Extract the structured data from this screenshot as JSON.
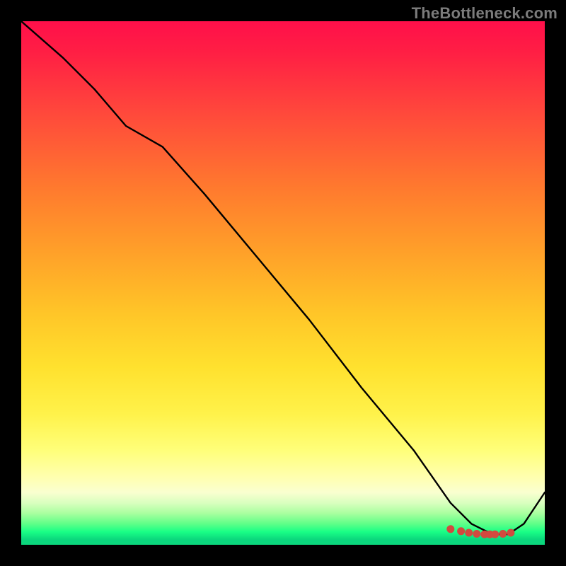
{
  "watermark": "TheBottleneck.com",
  "chart_data": {
    "type": "line",
    "title": "",
    "xlabel": "",
    "ylabel": "",
    "xlim": [
      0,
      100
    ],
    "ylim": [
      0,
      100
    ],
    "grid": false,
    "series": [
      {
        "name": "curve",
        "x": [
          0,
          8,
          14,
          20,
          27,
          35,
          45,
          55,
          65,
          75,
          82,
          86,
          90,
          93,
          96,
          100
        ],
        "values": [
          100,
          93,
          87,
          80,
          76,
          67,
          55,
          43,
          30,
          18,
          8,
          4,
          2,
          2,
          4,
          10
        ]
      }
    ],
    "markers": {
      "x": [
        82,
        84,
        85.5,
        87,
        88.5,
        89.5,
        90.5,
        92,
        93.5
      ],
      "values": [
        3.0,
        2.6,
        2.3,
        2.1,
        2.0,
        2.0,
        2.0,
        2.1,
        2.3
      ]
    },
    "background_gradient": {
      "orientation": "vertical",
      "stops": [
        {
          "pos": 0.0,
          "color": "#ff0f4a"
        },
        {
          "pos": 0.32,
          "color": "#ff7a2e"
        },
        {
          "pos": 0.66,
          "color": "#ffe12e"
        },
        {
          "pos": 0.87,
          "color": "#ffffae"
        },
        {
          "pos": 0.96,
          "color": "#5fff88"
        },
        {
          "pos": 1.0,
          "color": "#0bd77d"
        }
      ]
    }
  }
}
